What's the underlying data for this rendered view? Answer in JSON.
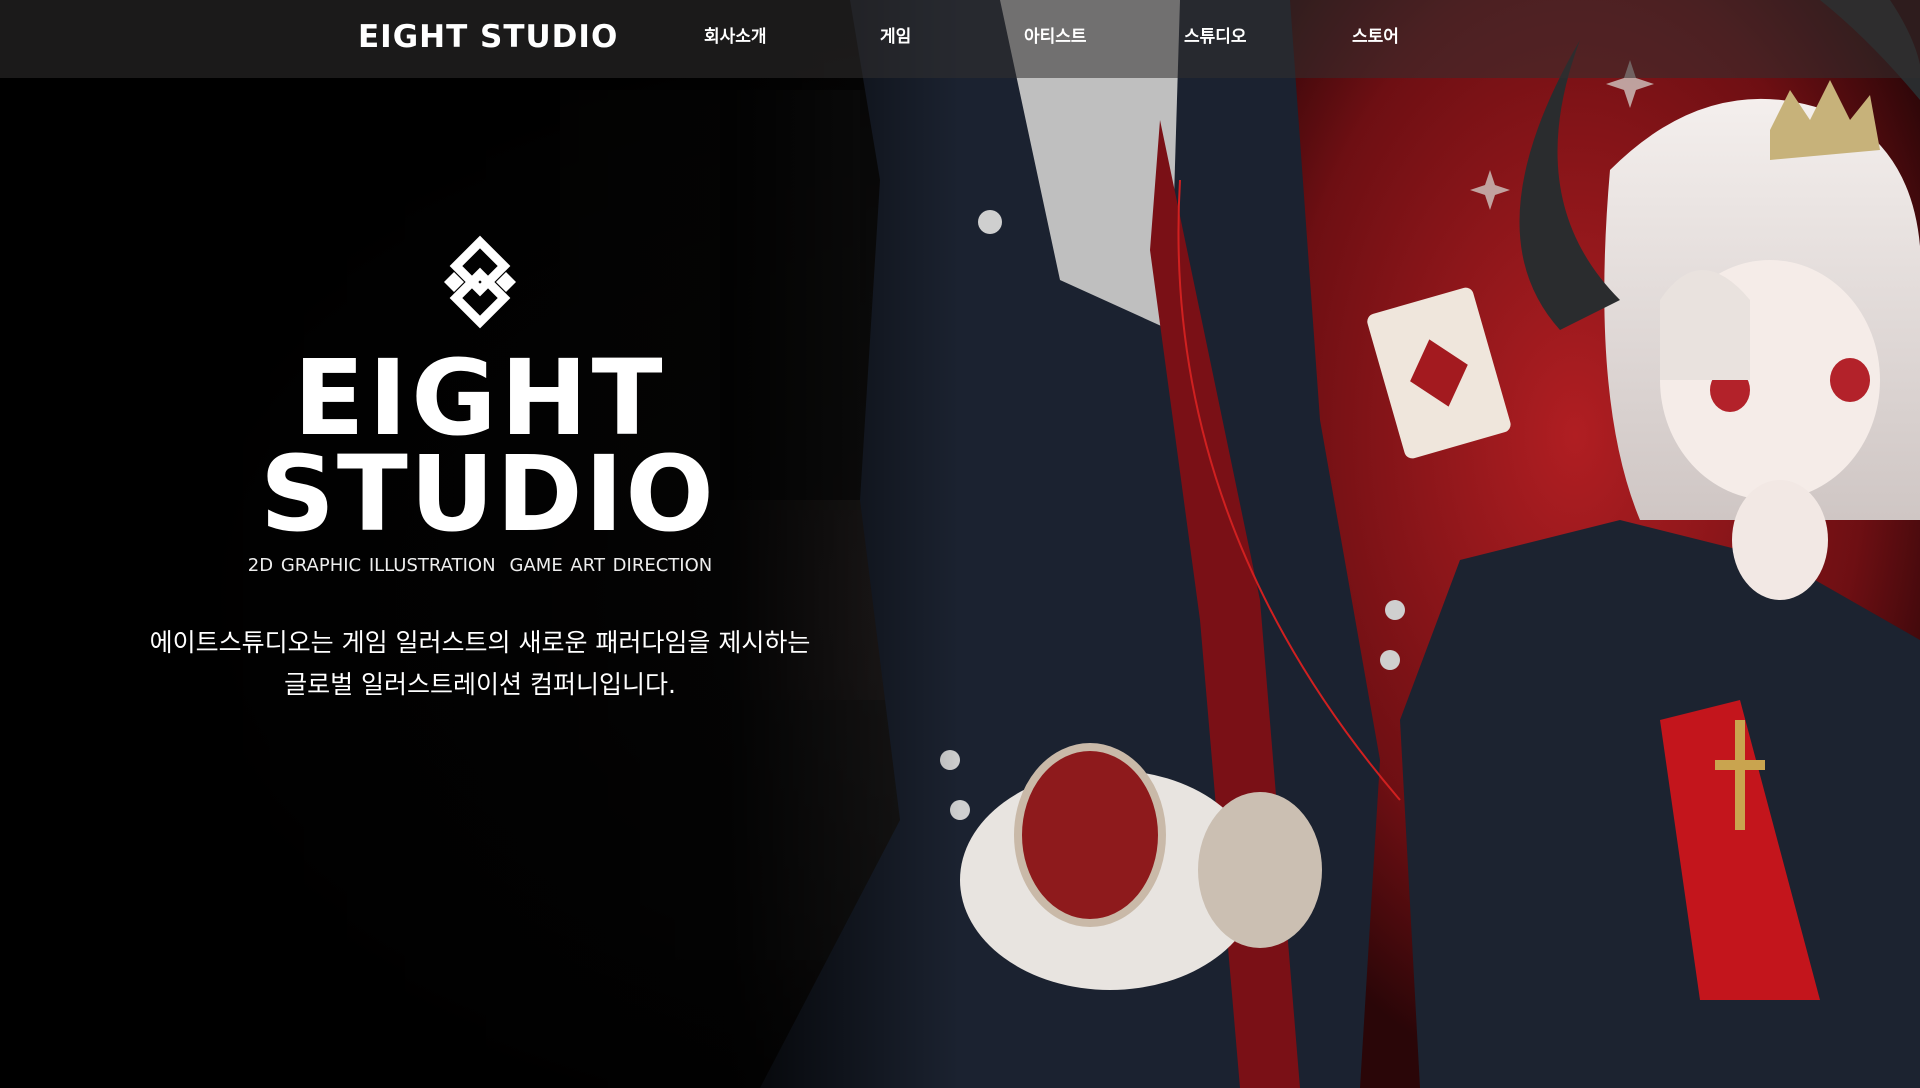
{
  "header": {
    "logo_text": "EIGHT STUDIO",
    "nav": [
      {
        "label": "회사소개"
      },
      {
        "label": "게임"
      },
      {
        "label": "아티스트"
      },
      {
        "label": "스튜디오"
      },
      {
        "label": "스토어"
      }
    ]
  },
  "hero": {
    "emblem_icon": "eight-studio-emblem-icon",
    "wordmark_line1": "EIGHT",
    "wordmark_line2": "STUDIO",
    "tagline_part1": "2D GRAPHIC ILLUSTRATION",
    "tagline_part2": "GAME ART DIRECTION",
    "description_line1": "에이트스튜디오는 게임 일러스트의 새로운 패러다임을 제시하는",
    "description_line2": "글로벌 일러스트레이션 컴퍼니입니다.",
    "artwork": "character-illustration-image"
  },
  "colors": {
    "background": "#000000",
    "nav_bar": "#323030",
    "accent_red": "#b3141c",
    "text": "#ffffff"
  }
}
